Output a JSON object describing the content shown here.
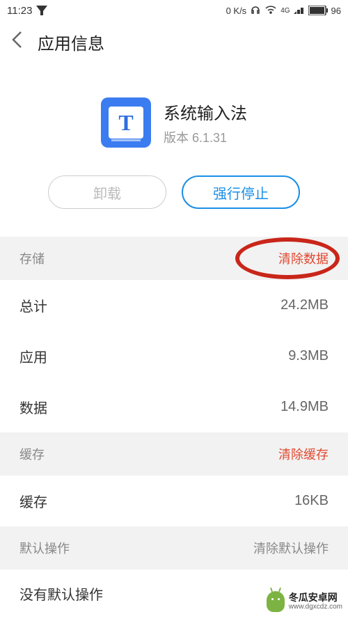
{
  "status": {
    "time": "11:23",
    "speed": "0 K/s",
    "network": "4G",
    "battery": "96"
  },
  "header": {
    "title": "应用信息"
  },
  "app": {
    "name": "系统输入法",
    "version": "版本 6.1.31",
    "icon_letter": "T"
  },
  "buttons": {
    "uninstall": "卸载",
    "force_stop": "强行停止"
  },
  "storage": {
    "header": "存储",
    "clear_action": "清除数据",
    "rows": [
      {
        "label": "总计",
        "value": "24.2MB"
      },
      {
        "label": "应用",
        "value": "9.3MB"
      },
      {
        "label": "数据",
        "value": "14.9MB"
      }
    ]
  },
  "cache": {
    "header": "缓存",
    "clear_action": "清除缓存",
    "rows": [
      {
        "label": "缓存",
        "value": "16KB"
      }
    ]
  },
  "default_ops": {
    "header": "默认操作",
    "clear_action": "清除默认操作",
    "text": "没有默认操作"
  },
  "watermark": {
    "name": "冬瓜安卓网",
    "url": "www.dgxcdz.com"
  }
}
